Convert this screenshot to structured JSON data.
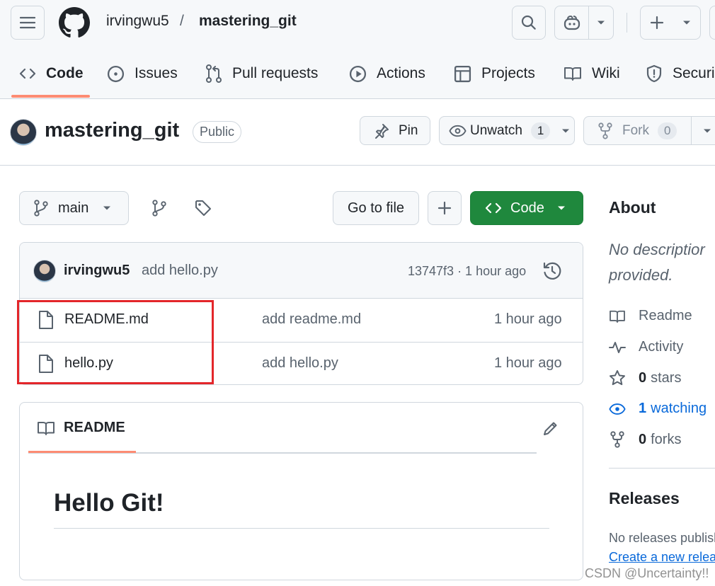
{
  "header": {
    "owner": "irvingwu5",
    "separator": "/",
    "repo": "mastering_git"
  },
  "tabs": [
    {
      "label": "Code",
      "icon": "code-icon"
    },
    {
      "label": "Issues",
      "icon": "issue-icon"
    },
    {
      "label": "Pull requests",
      "icon": "pull-request-icon"
    },
    {
      "label": "Actions",
      "icon": "play-icon"
    },
    {
      "label": "Projects",
      "icon": "table-icon"
    },
    {
      "label": "Wiki",
      "icon": "book-icon"
    },
    {
      "label": "Securi",
      "icon": "shield-icon"
    }
  ],
  "repo_header": {
    "name": "mastering_git",
    "visibility": "Public",
    "pin_label": "Pin",
    "unwatch_label": "Unwatch",
    "watch_count": "1",
    "fork_label": "Fork",
    "fork_count": "0"
  },
  "toolbar": {
    "branch": "main",
    "go_to_file": "Go to file",
    "add_label": "+",
    "code_label": "Code"
  },
  "latest_commit": {
    "author": "irvingwu5",
    "message": "add hello.py",
    "meta": "13747f3 · 1 hour ago"
  },
  "files": [
    {
      "name": "README.md",
      "message": "add readme.md",
      "time": "1 hour ago"
    },
    {
      "name": "hello.py",
      "message": "add hello.py",
      "time": "1 hour ago"
    }
  ],
  "readme": {
    "tab_label": "README",
    "heading": "Hello Git!"
  },
  "about": {
    "title": "About",
    "description_line1": "No descriptior",
    "description_line2": "provided.",
    "readme": "Readme",
    "activity": "Activity",
    "stars_count": "0",
    "stars_label": "stars",
    "watching_count": "1",
    "watching_label": "watching",
    "forks_count": "0",
    "forks_label": "forks"
  },
  "releases": {
    "title": "Releases",
    "none_text": "No releases publish",
    "create_link": "Create a new relea"
  },
  "watermark": "CSDN @Uncertainty!!",
  "colors": {
    "accent_green": "#1f883d",
    "link_blue": "#0969da",
    "tab_underline": "#fd8c73",
    "highlight_red": "#e3262a"
  }
}
